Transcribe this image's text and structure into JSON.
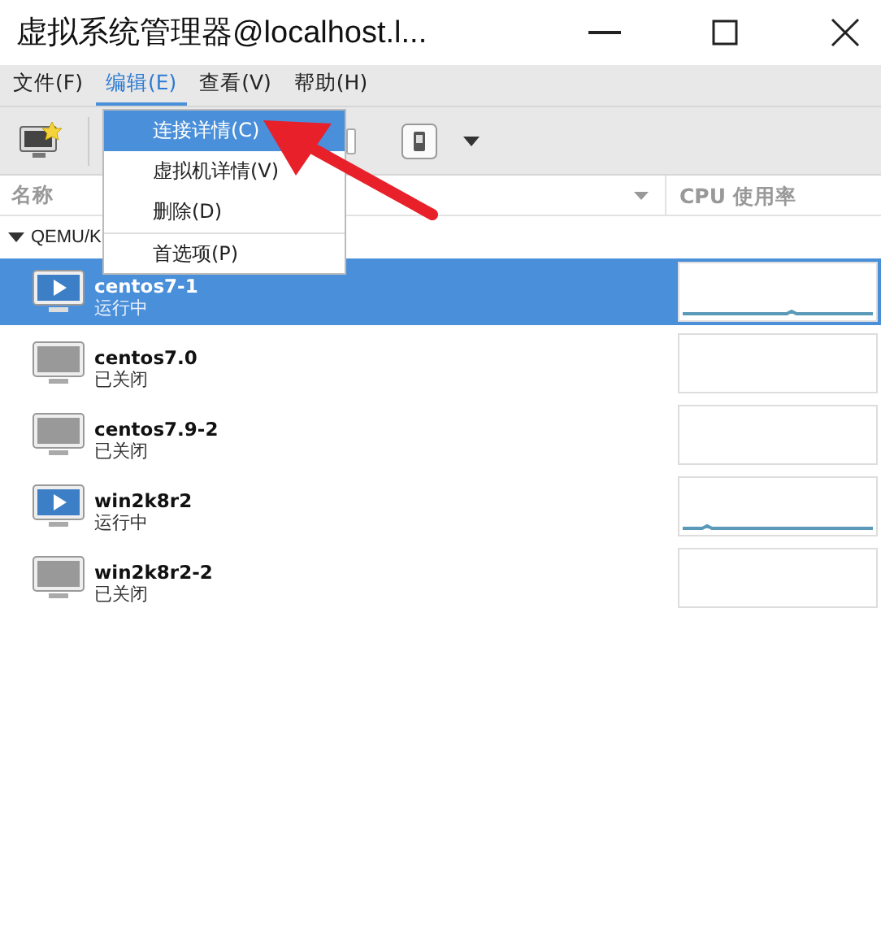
{
  "window": {
    "title": "虚拟系统管理器@localhost.l..."
  },
  "menubar": [
    {
      "label": "文件(F)",
      "selected": false
    },
    {
      "label": "编辑(E)",
      "selected": true
    },
    {
      "label": "查看(V)",
      "selected": false
    },
    {
      "label": "帮助(H)",
      "selected": false
    }
  ],
  "edit_menu": [
    {
      "label": "连接详情(C)",
      "selected": true,
      "separator_before": false
    },
    {
      "label": "虚拟机详情(V)",
      "selected": false,
      "separator_before": false
    },
    {
      "label": "删除(D)",
      "selected": false,
      "separator_before": false
    },
    {
      "label": "首选项(P)",
      "selected": false,
      "separator_before": true
    }
  ],
  "columns": [
    {
      "label": "名称"
    },
    {
      "label": "CPU 使用率"
    }
  ],
  "group": {
    "label": "QEMU/K",
    "expanded": true
  },
  "vms": [
    {
      "name": "centos7-1",
      "status": "运行中",
      "running": true,
      "selected": true
    },
    {
      "name": "centos7.0",
      "status": "已关闭",
      "running": false,
      "selected": false
    },
    {
      "name": "centos7.9-2",
      "status": "已关闭",
      "running": false,
      "selected": false
    },
    {
      "name": "win2k8r2",
      "status": "运行中",
      "running": true,
      "selected": false
    },
    {
      "name": "win2k8r2-2",
      "status": "已关闭",
      "running": false,
      "selected": false
    }
  ]
}
